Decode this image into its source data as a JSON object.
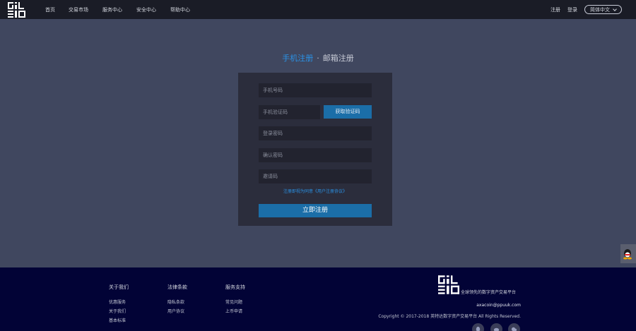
{
  "header": {
    "nav": [
      "首页",
      "交易市场",
      "服务中心",
      "安全中心",
      "帮助中心"
    ],
    "register": "注册",
    "login": "登录",
    "language": "简体中文"
  },
  "tabs": {
    "phone": "手机注册",
    "separator": "·",
    "email": "邮箱注册"
  },
  "form": {
    "phone_placeholder": "手机号码",
    "sms_code_placeholder": "手机验证码",
    "get_code_button": "获取验证码",
    "password_placeholder": "登录密码",
    "confirm_password_placeholder": "确认密码",
    "invite_code_placeholder": "邀请码",
    "agreement_text": "注册即视为同意《用户注册协议》",
    "submit_button": "立即注册"
  },
  "footer": {
    "columns": [
      {
        "title": "关于我们",
        "items": [
          "优惠服务",
          "关于我们",
          "基本标准"
        ]
      },
      {
        "title": "法律条款",
        "items": [
          "隐私条款",
          "用户协议"
        ]
      },
      {
        "title": "服务支持",
        "items": [
          "常见问题",
          "上币申请"
        ]
      }
    ],
    "slogan": "全球领先的数字资产交易平台",
    "email": "axacoin@ppuuk.com",
    "copyright": "Copyright © 2017-2018 英特达数字资产交易平台 All Rights Reserved."
  },
  "colors": {
    "background": "#40475f",
    "header": "#1a1c26",
    "panel": "#2b2d3c",
    "accent": "#1b6ea8",
    "link": "#2a92e6",
    "footer": "#020336"
  },
  "icons": [
    "site-logo-icon",
    "chevron-down-icon",
    "qq-icon",
    "footer-logo-icon",
    "qq-social-icon",
    "weibo-social-icon",
    "wechat-social-icon"
  ]
}
